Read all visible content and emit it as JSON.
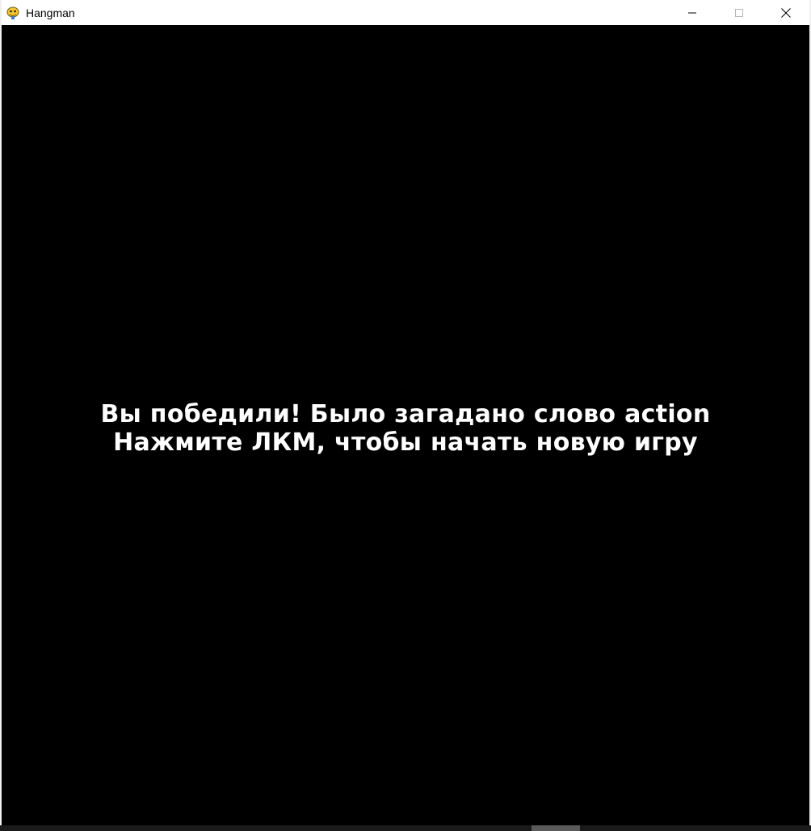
{
  "window": {
    "title": "Hangman",
    "icon": "pygame-snake-icon",
    "controls": [
      "minimize-icon",
      "maximize-icon",
      "close-icon"
    ]
  },
  "game": {
    "message_line1": "Вы победили! Было загадано слово action",
    "message_line2": "Нажмите ЛКМ, чтобы начать новую игру",
    "text_color": "#ffffff",
    "background_color": "#000000"
  }
}
